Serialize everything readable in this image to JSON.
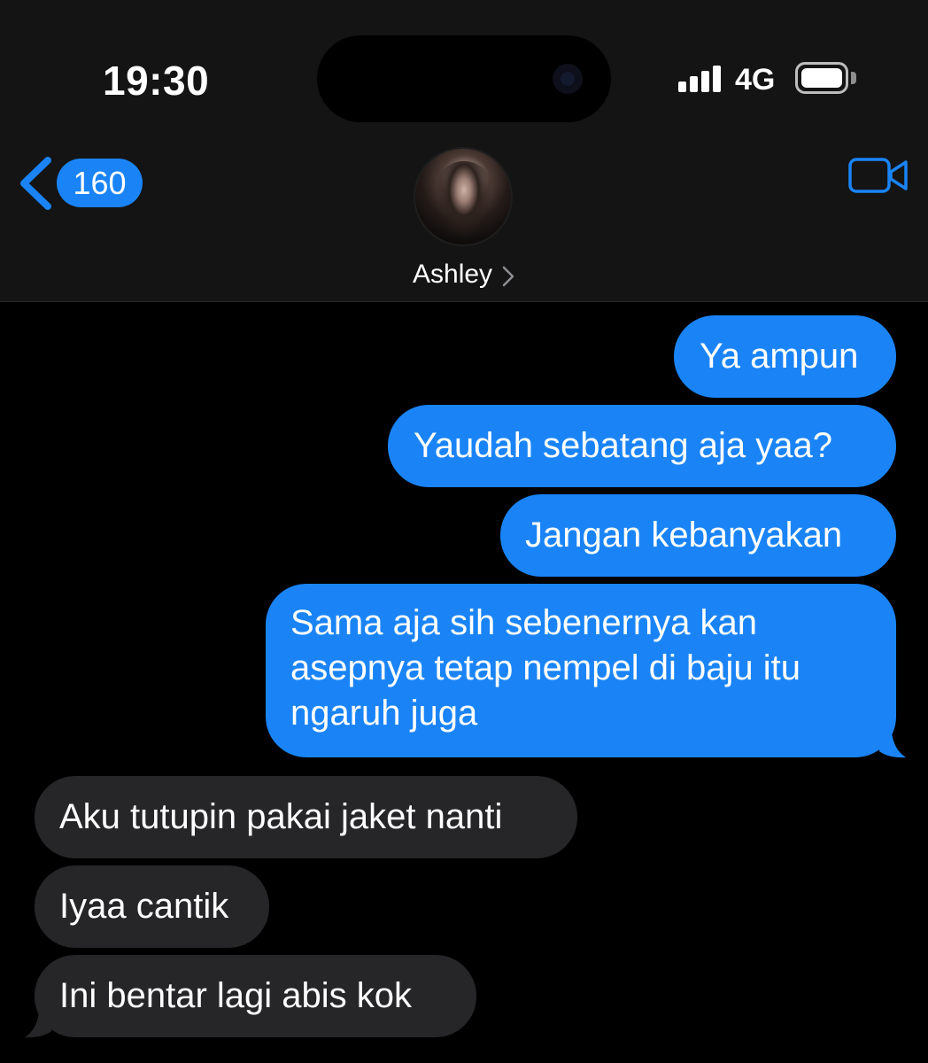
{
  "status_bar": {
    "time": "19:30",
    "network": "4G"
  },
  "nav": {
    "unread_count": "160",
    "contact_name": "Ashley"
  },
  "messages": [
    {
      "direction": "sent",
      "text": "Ya ampun"
    },
    {
      "direction": "sent",
      "text": "Yaudah sebatang aja yaa?"
    },
    {
      "direction": "sent",
      "text": "Jangan kebanyakan"
    },
    {
      "direction": "sent",
      "lines": [
        "Sama aja sih sebenernya kan",
        "asepnya tetap nempel di baju itu",
        "ngaruh juga"
      ]
    },
    {
      "direction": "received",
      "text": "Aku tutupin pakai jaket nanti"
    },
    {
      "direction": "received",
      "text": "Iyaa cantik"
    },
    {
      "direction": "received",
      "text": "Ini bentar lagi abis kok"
    }
  ],
  "colors": {
    "sent_bubble": "#1a84f7",
    "received_bubble": "#262628",
    "header_background": "#141414",
    "accent": "#1a84f7"
  },
  "icons": [
    "back-chevron-icon",
    "video-camera-icon",
    "signal-bars-icon",
    "battery-icon",
    "contact-chevron-icon"
  ]
}
